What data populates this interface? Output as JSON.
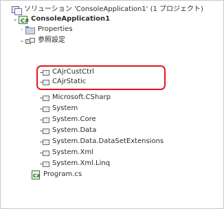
{
  "solution_explorer": {
    "solution_label": "ソリューション 'ConsoleApplication1' (1 プロジェクト)",
    "project_label": "ConsoleApplication1",
    "properties_label": "Properties",
    "references_label": "参照設定",
    "references": [
      "CAjrCustCtrl",
      "CAjrStatic",
      "Microsoft.CSharp",
      "System",
      "System.Core",
      "System.Data",
      "System.Data.DataSetExtensions",
      "System.Xml",
      "System.Xml.Linq"
    ],
    "program_file_label": "Program.cs"
  },
  "icons": {
    "solution": "solution-icon",
    "project": "csharp-project-icon",
    "properties": "folder-icon",
    "references": "references-icon",
    "reference": "reference-icon",
    "program_file": "csharp-file-icon"
  },
  "colors": {
    "highlight": "#e3141c",
    "border": "#c9c9c9"
  }
}
